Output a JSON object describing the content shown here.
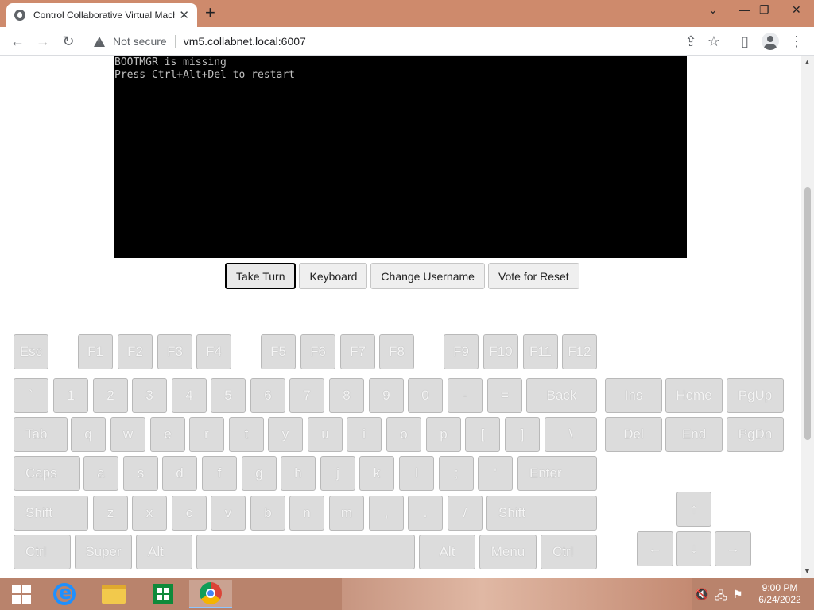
{
  "browser": {
    "tab_title": "Control Collaborative Virtual Machine",
    "new_tab_icon": "+",
    "close_tab_icon": "✕",
    "url_warning": "Not secure",
    "url": "vm5.collabnet.local:6007",
    "window_controls": {
      "dropdown": "⌄",
      "minimize": "—",
      "restore": "❐",
      "close": "✕"
    },
    "nav": {
      "back": "←",
      "forward": "→",
      "reload": "↻"
    },
    "actions": {
      "share": "⇪",
      "bookmark": "☆",
      "sidepanel": "▯",
      "menu": "⋮"
    }
  },
  "vm": {
    "lines": [
      "BOOTMGR is missing",
      "Press Ctrl+Alt+Del to restart"
    ]
  },
  "controls": {
    "take_turn": "Take Turn",
    "keyboard": "Keyboard",
    "change_username": "Change Username",
    "vote_reset": "Vote for Reset"
  },
  "keyboard": {
    "function_row": [
      "Esc",
      "F1",
      "F2",
      "F3",
      "F4",
      "F5",
      "F6",
      "F7",
      "F8",
      "F9",
      "F10",
      "F11",
      "F12"
    ],
    "number_row": [
      "`",
      "1",
      "2",
      "3",
      "4",
      "5",
      "6",
      "7",
      "8",
      "9",
      "0",
      "-",
      "=",
      "Back"
    ],
    "q_row": [
      "Tab",
      "q",
      "w",
      "e",
      "r",
      "t",
      "y",
      "u",
      "i",
      "o",
      "p",
      "[",
      "]",
      "\\"
    ],
    "a_row": [
      "Caps",
      "a",
      "s",
      "d",
      "f",
      "g",
      "h",
      "j",
      "k",
      "l",
      ";",
      "'",
      "Enter"
    ],
    "z_row": [
      "Shift",
      "z",
      "x",
      "c",
      "v",
      "b",
      "n",
      "m",
      ",",
      ".",
      "/",
      "Shift"
    ],
    "bottom_row": [
      "Ctrl",
      "Super",
      "Alt",
      "",
      "Alt",
      "Menu",
      "Ctrl"
    ],
    "nav_top": [
      "Ins",
      "Home",
      "PgUp"
    ],
    "nav_bottom": [
      "Del",
      "End",
      "PgDn"
    ],
    "arrows": {
      "up": "↑",
      "left": "←",
      "down": "↓",
      "right": "→"
    }
  },
  "taskbar": {
    "time": "9:00 PM",
    "date": "6/24/2022"
  }
}
